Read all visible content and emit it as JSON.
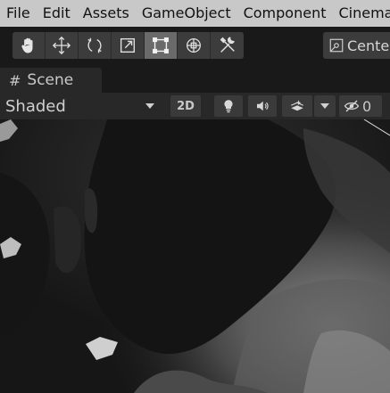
{
  "menu": {
    "items": [
      "File",
      "Edit",
      "Assets",
      "GameObject",
      "Component",
      "Cinemachine"
    ]
  },
  "toolbar": {
    "tools": [
      {
        "name": "hand-tool",
        "icon": "hand-icon"
      },
      {
        "name": "move-tool",
        "icon": "move-icon"
      },
      {
        "name": "rotate-tool",
        "icon": "rotate-icon"
      },
      {
        "name": "scale-tool",
        "icon": "scale-icon"
      },
      {
        "name": "rect-tool",
        "icon": "rect-icon",
        "active": true
      },
      {
        "name": "transform-tool",
        "icon": "transform-icon"
      },
      {
        "name": "custom-tool",
        "icon": "tools-icon"
      }
    ],
    "pivot_label": "Center"
  },
  "tabs": [
    {
      "label": "Scene",
      "icon": "grid-hash-icon"
    }
  ],
  "scene_toolbar": {
    "shading_mode": "Shaded",
    "mode_2d_label": "2D",
    "hidden_count": "0"
  },
  "colors": {
    "menubar_bg": "#c8c8c8",
    "toolbar_bg": "#191919",
    "active_tool_bg": "#6a6a6a",
    "panel_bg": "#282828"
  }
}
